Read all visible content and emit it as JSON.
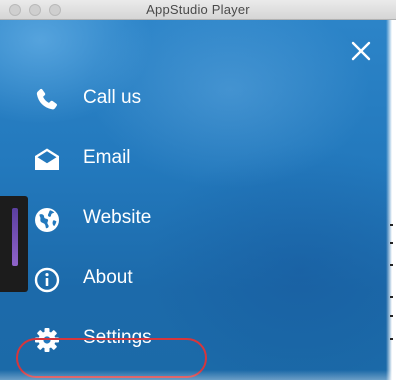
{
  "window": {
    "title": "AppStudio Player"
  },
  "menu": {
    "items": [
      {
        "id": "call",
        "label": "Call us",
        "icon": "phone-icon"
      },
      {
        "id": "email",
        "label": "Email",
        "icon": "envelope-open-icon"
      },
      {
        "id": "website",
        "label": "Website",
        "icon": "globe-icon"
      },
      {
        "id": "about",
        "label": "About",
        "icon": "info-circle-icon"
      },
      {
        "id": "settings",
        "label": "Settings",
        "icon": "gear-icon"
      }
    ]
  },
  "colors": {
    "background": "#2379bd",
    "text": "#ffffff",
    "highlight_ring": "#d6363c",
    "side_handle": "#1c1c1c",
    "side_handle_bar": "#7d55bd"
  }
}
